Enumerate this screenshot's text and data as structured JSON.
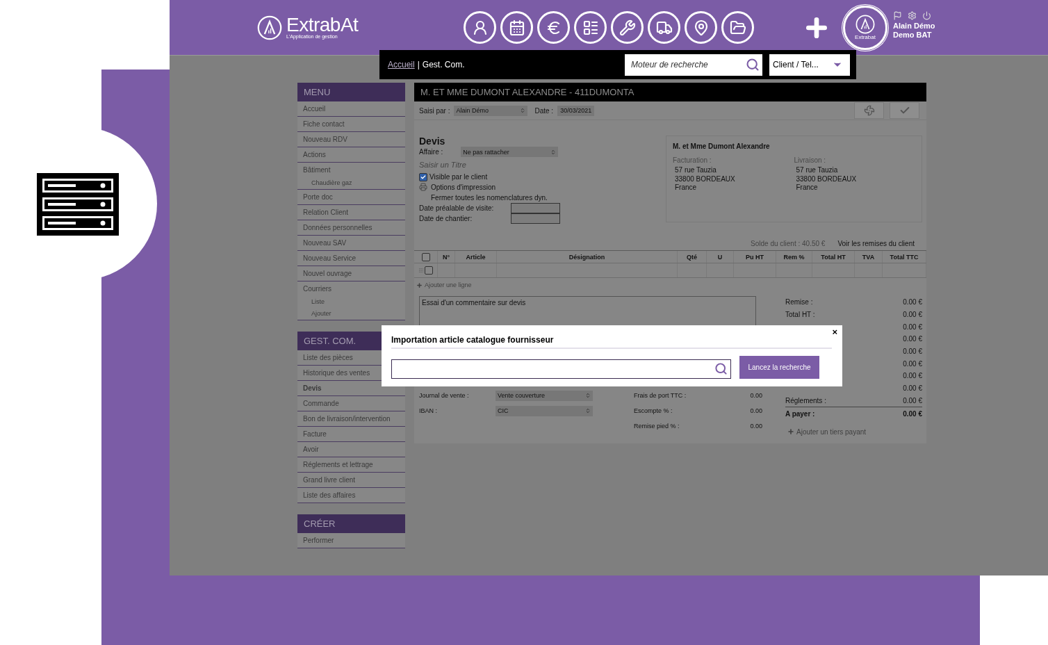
{
  "brand": {
    "name": "ExtrabAt",
    "tagline": "L'Application de gestion"
  },
  "user": {
    "avatar_label": "Extrabat",
    "name": "Alain Démo",
    "company": "Demo BAT"
  },
  "breadcrumb": {
    "items": [
      {
        "label": "Accueil",
        "link": true
      },
      {
        "label": "Gest. Com.",
        "link": false
      }
    ],
    "separator": "|"
  },
  "search": {
    "placeholder": "Moteur de recherche"
  },
  "search_scope": "Client / Tel...",
  "menu_sections": [
    {
      "title": "MENU",
      "items": [
        {
          "label": "Accueil",
          "selected": false
        },
        {
          "label": "Fiche contact",
          "selected": false
        },
        {
          "label": "Nouveau RDV",
          "selected": false
        },
        {
          "label": "Actions",
          "selected": false
        },
        {
          "label": "Bâtiment",
          "selected": false,
          "children": [
            {
              "label": "Chaudière gaz"
            }
          ]
        },
        {
          "label": "Porte doc",
          "selected": false
        },
        {
          "label": "Relation Client",
          "selected": false
        },
        {
          "label": "Données personnelles",
          "selected": false
        },
        {
          "label": "Nouveau SAV",
          "selected": false
        },
        {
          "label": "Nouveau Service",
          "selected": false
        },
        {
          "label": "Nouvel ouvrage",
          "selected": false
        },
        {
          "label": "Courriers",
          "selected": false,
          "children": [
            {
              "label": "Liste"
            },
            {
              "label": "Ajouter"
            }
          ]
        }
      ]
    },
    {
      "title": "GEST. COM.",
      "items": [
        {
          "label": "Liste des pièces",
          "selected": false
        },
        {
          "label": "Historique des ventes",
          "selected": false
        },
        {
          "label": "Devis",
          "selected": true
        },
        {
          "label": "Commande",
          "selected": false
        },
        {
          "label": "Bon de livraison/intervention",
          "selected": false
        },
        {
          "label": "Facture",
          "selected": false
        },
        {
          "label": "Avoir",
          "selected": false
        },
        {
          "label": "Réglements et lettrage",
          "selected": false
        },
        {
          "label": "Grand livre client",
          "selected": false
        },
        {
          "label": "Liste des affaires",
          "selected": false
        }
      ]
    },
    {
      "title": "CRÉER",
      "items": [
        {
          "label": "Performer",
          "selected": false
        }
      ]
    }
  ],
  "document": {
    "title": "M. ET MME DUMONT ALEXANDRE - 411DUMONTA",
    "entered_by": {
      "label": "Saisi par :",
      "value": "Alain Démo"
    },
    "date": {
      "label": "Date :",
      "value": "30/03/2021"
    },
    "heading": "Devis",
    "affaire": {
      "label": "Affaire :",
      "value": "Ne pas rattacher"
    },
    "title_placeholder": "Saisir un Titre",
    "visible": {
      "label": "Visible par le client",
      "checked": true
    },
    "print_options": "Options d'impression",
    "close_nomenclatures": "Fermer toutes les nomenclatures dyn.",
    "date_fields": [
      {
        "label": "Date préalable de visite:"
      },
      {
        "label": "Date de chantier:"
      }
    ],
    "client": {
      "name": "M. et Mme Dumont Alexandre",
      "billing": {
        "label": "Facturation :",
        "lines": [
          "57 rue Tauzia",
          "33800 BORDEAUX",
          "France"
        ]
      },
      "delivery": {
        "label": "Livraison :",
        "lines": [
          "57 rue Tauzia",
          "33800 BORDEAUX",
          "France"
        ]
      }
    },
    "balance": "Solde du client : 40.50 €",
    "discounts_link": "Voir les remises du client",
    "table": {
      "select_all_checked": false,
      "columns": [
        "N°",
        "Article",
        "Désignation",
        "Qté",
        "U",
        "Pu HT",
        "Rem %",
        "Total HT",
        "TVA",
        "Total TTC"
      ],
      "rows": [
        {
          "checked": false
        }
      ]
    },
    "add_line": "Ajouter une ligne",
    "comment": "Essai d'un commentaire sur devis",
    "footer_fields": [
      {
        "label": "Journal de vente :",
        "value": "Vente couverture",
        "side_label": "Frais de port TTC :",
        "side_value": "0.00"
      },
      {
        "label": "IBAN :",
        "value": "CIC",
        "side_label": "Escompte % :",
        "side_value": "0.00"
      },
      {
        "side_label": "Remise pied % :",
        "side_value": "0.00"
      }
    ],
    "totals": [
      {
        "label": "Remise :",
        "value": "0.00 €",
        "strong": false
      },
      {
        "label": "Total HT :",
        "value": "0.00 €",
        "strong": false
      },
      {
        "value": "0.00 €",
        "strong": false
      },
      {
        "value": "0.00 €",
        "strong": false
      },
      {
        "value": "0.00 €",
        "strong": false
      },
      {
        "value": "0.00 €",
        "strong": false
      },
      {
        "value": "0.00 €",
        "strong": false
      },
      {
        "value": "0.00 €",
        "strong": false
      },
      {
        "label": "Réglements :",
        "value": "0.00 €",
        "strong": false
      },
      {
        "label": "A payer :",
        "value": "0.00 €",
        "strong": true
      }
    ],
    "add_payer": "Ajouter un tiers payant"
  },
  "modal": {
    "title": "Importation article catalogue fournisseur",
    "close": "×",
    "button": "Lancez la recherche"
  }
}
